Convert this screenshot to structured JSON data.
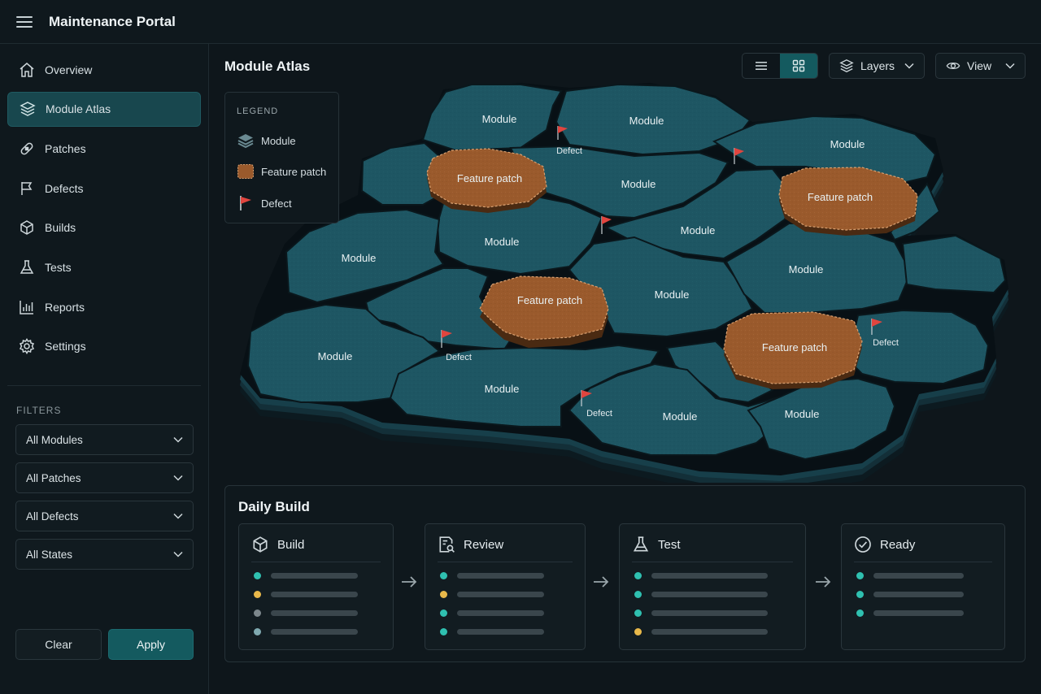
{
  "app": {
    "title": "Maintenance Portal"
  },
  "sidebar": {
    "items": [
      {
        "label": "Overview",
        "icon": "home-icon"
      },
      {
        "label": "Module Atlas",
        "icon": "layers-icon",
        "active": true
      },
      {
        "label": "Patches",
        "icon": "bandage-icon"
      },
      {
        "label": "Defects",
        "icon": "flag-icon"
      },
      {
        "label": "Builds",
        "icon": "cube-icon"
      },
      {
        "label": "Tests",
        "icon": "flask-icon"
      },
      {
        "label": "Reports",
        "icon": "bar-chart-icon"
      },
      {
        "label": "Settings",
        "icon": "gear-icon"
      }
    ],
    "filters_title": "FILTERS",
    "filters": [
      {
        "value": "All Modules"
      },
      {
        "value": "All Patches"
      },
      {
        "value": "All Defects"
      },
      {
        "value": "All States"
      }
    ],
    "clear_label": "Clear",
    "apply_label": "Apply"
  },
  "main": {
    "title": "Module Atlas",
    "layers_label": "Layers",
    "view_label": "View",
    "view_mode": "grid"
  },
  "legend": {
    "title": "LEGEND",
    "items": [
      {
        "label": "Module",
        "icon": "stack-icon"
      },
      {
        "label": "Feature patch",
        "icon": "patch-icon"
      },
      {
        "label": "Defect",
        "icon": "red-flag-icon"
      }
    ]
  },
  "map": {
    "module_label": "Module",
    "patch_label": "Feature patch",
    "defect_label": "Defect",
    "colors": {
      "module": "#1e5663",
      "patch": "#9a5a2c",
      "flag": "#e0453f",
      "crack": "#081015"
    }
  },
  "build": {
    "title": "Daily Build",
    "stages": [
      {
        "label": "Build",
        "icon": "cube-icon",
        "dots": [
          "#2fc0b0",
          "#e8b84a",
          "#7c878c",
          "#7fa9b0"
        ]
      },
      {
        "label": "Review",
        "icon": "document-search-icon",
        "dots": [
          "#2fc0b0",
          "#e8b84a",
          "#2fc0b0",
          "#2fc0b0"
        ]
      },
      {
        "label": "Test",
        "icon": "flask-icon",
        "dots": [
          "#2fc0b0",
          "#2fc0b0",
          "#2fc0b0",
          "#e8b84a"
        ]
      },
      {
        "label": "Ready",
        "icon": "check-circle-icon",
        "dots": [
          "#2fc0b0",
          "#2fc0b0",
          "#2fc0b0"
        ]
      }
    ]
  }
}
